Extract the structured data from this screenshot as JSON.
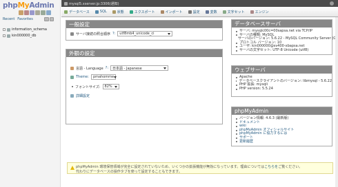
{
  "sidebar": {
    "logo_php": "php",
    "logo_my": "My",
    "logo_admin": "Admin",
    "tab_recent": "Recent",
    "tab_favorites": "Favorites",
    "databases": [
      "information_schema",
      "kin000000_db"
    ]
  },
  "topbar": {
    "server": "mysql5.xserver.jp:3306(通知)"
  },
  "menu": [
    {
      "label": "データベース",
      "color": "#8a6"
    },
    {
      "label": "SQL",
      "color": "#58a"
    },
    {
      "label": "状態",
      "color": "#a96"
    },
    {
      "label": "エクスポート",
      "color": "#3a8"
    },
    {
      "label": "インポート",
      "color": "#a86"
    },
    {
      "label": "設定",
      "color": "#777"
    },
    {
      "label": "変数",
      "color": "#679"
    },
    {
      "label": "文字セット",
      "color": "#8a8"
    },
    {
      "label": "エンジン",
      "color": "#a88"
    }
  ],
  "general": {
    "title": "一般設定",
    "collation_label": "サーバ接続の照合順序",
    "collation_value": "utf8mb4_unicode_ci"
  },
  "appearance": {
    "title": "外観の設定",
    "lang_label": "言語 - Language",
    "lang_value": "日本語 - Japanese",
    "theme_label": "Theme:",
    "theme_value": "pmahomme",
    "fontsize_label": "フォントサイズ:",
    "fontsize_value": "82%",
    "more_label": "詳細設定"
  },
  "dbserver": {
    "title": "データベースサーバ",
    "items": [
      "サーバ: mysqlc00c=00sapsa.net via TCP/IP",
      "サーバの種類: MySQL",
      "サーバのバージョン: 5.6.22 - MySQL Community Server (GPL)",
      "プロトコル バージョン: 10",
      "ユーザ: kin000000@sv400-xbapsa.net",
      "サーバの文字セット: UTF-8 Unicode (utf8)"
    ]
  },
  "webserver": {
    "title": "ウェブサーバ",
    "items": [
      "Apache",
      "データベースクライアントのバージョン: libmysql - 5.6.22",
      "PHP 拡張: mysqli",
      "PHP version: 5.5.24"
    ]
  },
  "pma": {
    "title": "phpMyAdmin",
    "items": [
      "バージョン情報: 4.6.3 (最新版)",
      "ドキュメント",
      "wiki",
      "phpMyAdmin オフィシャルサイト",
      "phpMyAdmin に協力するには",
      "サポート",
      "更新履歴"
    ]
  },
  "notice": {
    "line1": "phpMyAdmin 環境保管領域が完全に設定されていないため、いくつかの拡張機能が無効になっています。理由については",
    "link": "こちらを",
    "line1_end": "ご覧ください。",
    "line2": "代わりにデータベースの操作タブを使って設定することもできます。"
  }
}
